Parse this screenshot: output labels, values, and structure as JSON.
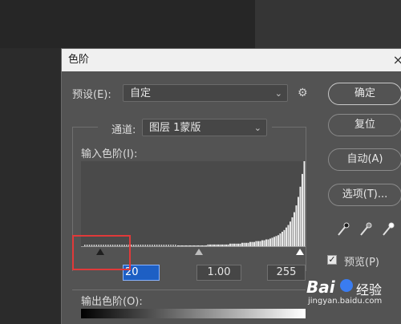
{
  "dialog": {
    "title": "色阶",
    "close_glyph": "×"
  },
  "preset": {
    "label": "预设(E):",
    "value": "自定",
    "chev": "⌄",
    "gear_glyph": "⚙"
  },
  "channel": {
    "label": "通道:",
    "value": "图层 1蒙版",
    "chev": "⌄"
  },
  "input_levels": {
    "label": "输入色阶(I):",
    "black": "20",
    "gamma": "1.00",
    "white": "255"
  },
  "output_levels": {
    "label": "输出色阶(O):"
  },
  "buttons": {
    "ok": "确定",
    "reset": "复位",
    "auto": "自动(A)",
    "options": "选项(T)..."
  },
  "eyedroppers": [
    "eyedropper-black-icon",
    "eyedropper-gray-icon",
    "eyedropper-white-icon"
  ],
  "preview": {
    "label": "预览(P)",
    "checked": true,
    "check_glyph": "✓"
  },
  "watermark": {
    "brand": "Bai",
    "product": "经验",
    "url": "jingyan.baidu.com"
  },
  "histogram": {
    "description_note_omitted": true,
    "heights": [
      1,
      1,
      1,
      1,
      1,
      1,
      1,
      1,
      1,
      1,
      1,
      1,
      1,
      1,
      1,
      2,
      2,
      2,
      2,
      2,
      2,
      2,
      2,
      2,
      2,
      2,
      3,
      3,
      3,
      3,
      3,
      3,
      4,
      4,
      4,
      4,
      5,
      5,
      5,
      6,
      6,
      6,
      7,
      7,
      8,
      8,
      9,
      10,
      11,
      12,
      13,
      15,
      17,
      19,
      22,
      25,
      29,
      34,
      40,
      48,
      58,
      70,
      85,
      100
    ]
  }
}
